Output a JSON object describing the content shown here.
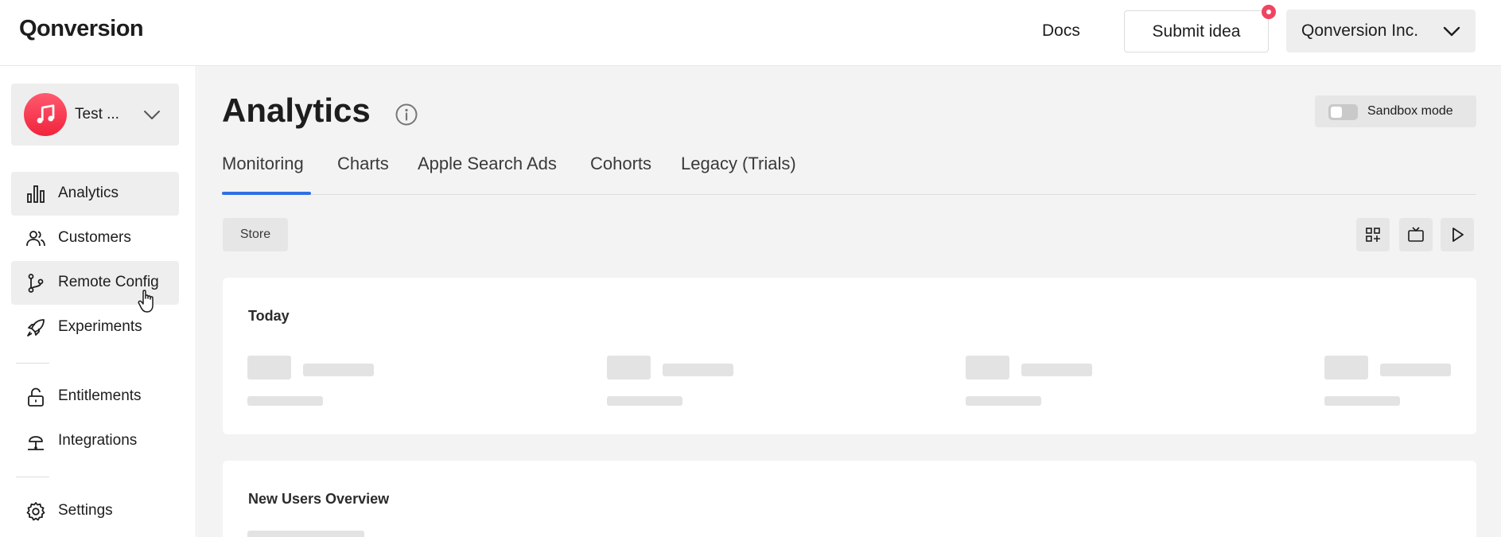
{
  "header": {
    "logo": "Qonversion",
    "docs_label": "Docs",
    "submit_label": "Submit idea",
    "org_label": "Qonversion Inc."
  },
  "sidebar": {
    "app_name": "Test ...",
    "items": [
      {
        "label": "Analytics",
        "icon": "bar-chart-icon"
      },
      {
        "label": "Customers",
        "icon": "users-icon"
      },
      {
        "label": "Remote Config",
        "icon": "git-branch-icon"
      },
      {
        "label": "Experiments",
        "icon": "rocket-icon"
      },
      {
        "label": "Entitlements",
        "icon": "lock-icon"
      },
      {
        "label": "Integrations",
        "icon": "integration-icon"
      },
      {
        "label": "Settings",
        "icon": "gear-icon"
      }
    ]
  },
  "main": {
    "title": "Analytics",
    "sandbox_label": "Sandbox mode",
    "tabs": [
      "Monitoring",
      "Charts",
      "Apple Search Ads",
      "Cohorts",
      "Legacy (Trials)"
    ],
    "filter_label": "Store",
    "cards": {
      "today_title": "Today",
      "new_users_title": "New Users Overview"
    }
  },
  "colors": {
    "accent": "#2f6fe4",
    "notification": "#f04461",
    "app_icon": "#f0243c"
  }
}
